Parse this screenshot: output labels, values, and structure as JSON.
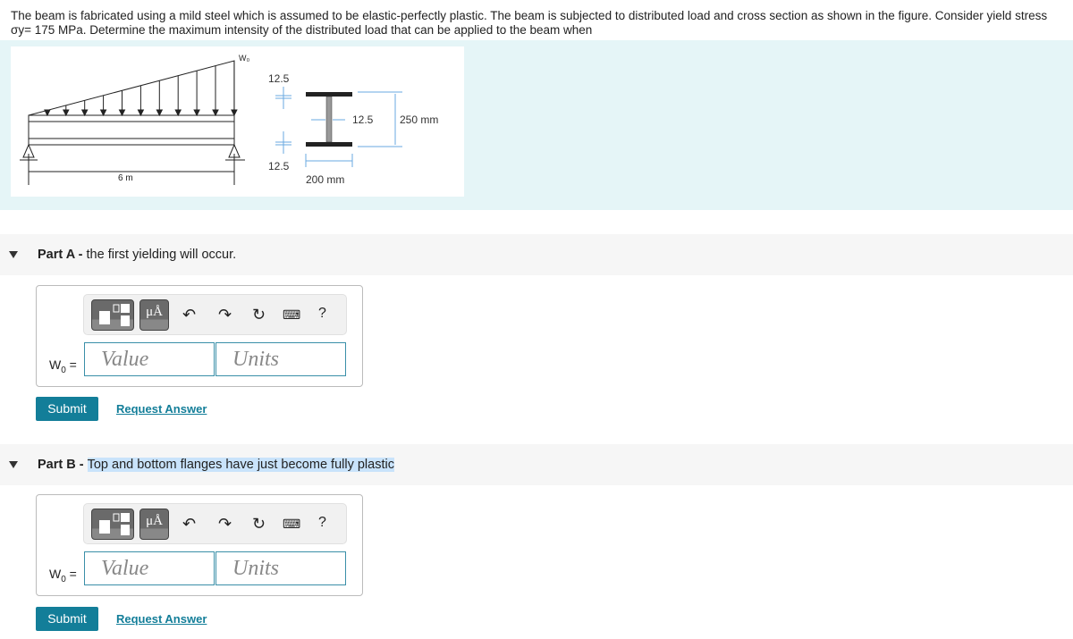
{
  "problem": "The beam is fabricated using a mild steel which is assumed to be elastic-perfectly plastic. The beam is subjected to distributed load and cross section as shown in the figure. Consider yield stress σy= 175 MPa. Determine the maximum intensity of the distributed load that can be applied to the beam when",
  "figure": {
    "load_label": "W₀",
    "span": "6 m",
    "flange_top": "12.5",
    "flange_bottom": "12.5",
    "web": "12.5",
    "depth": "250 mm",
    "width": "200 mm"
  },
  "parts": [
    {
      "prefix": "Part A - ",
      "title": "the first yielding will occur.",
      "var": "W",
      "sub": "0",
      "value_placeholder": "Value",
      "units_placeholder": "Units",
      "submit": "Submit",
      "request": "Request Answer",
      "mu": "μÅ",
      "help": "?"
    },
    {
      "prefix": "Part B - ",
      "title": "Top and bottom flanges have just become fully plastic",
      "var": "W",
      "sub": "0",
      "value_placeholder": "Value",
      "units_placeholder": "Units",
      "submit": "Submit",
      "request": "Request Answer",
      "mu": "μÅ",
      "help": "?"
    }
  ]
}
